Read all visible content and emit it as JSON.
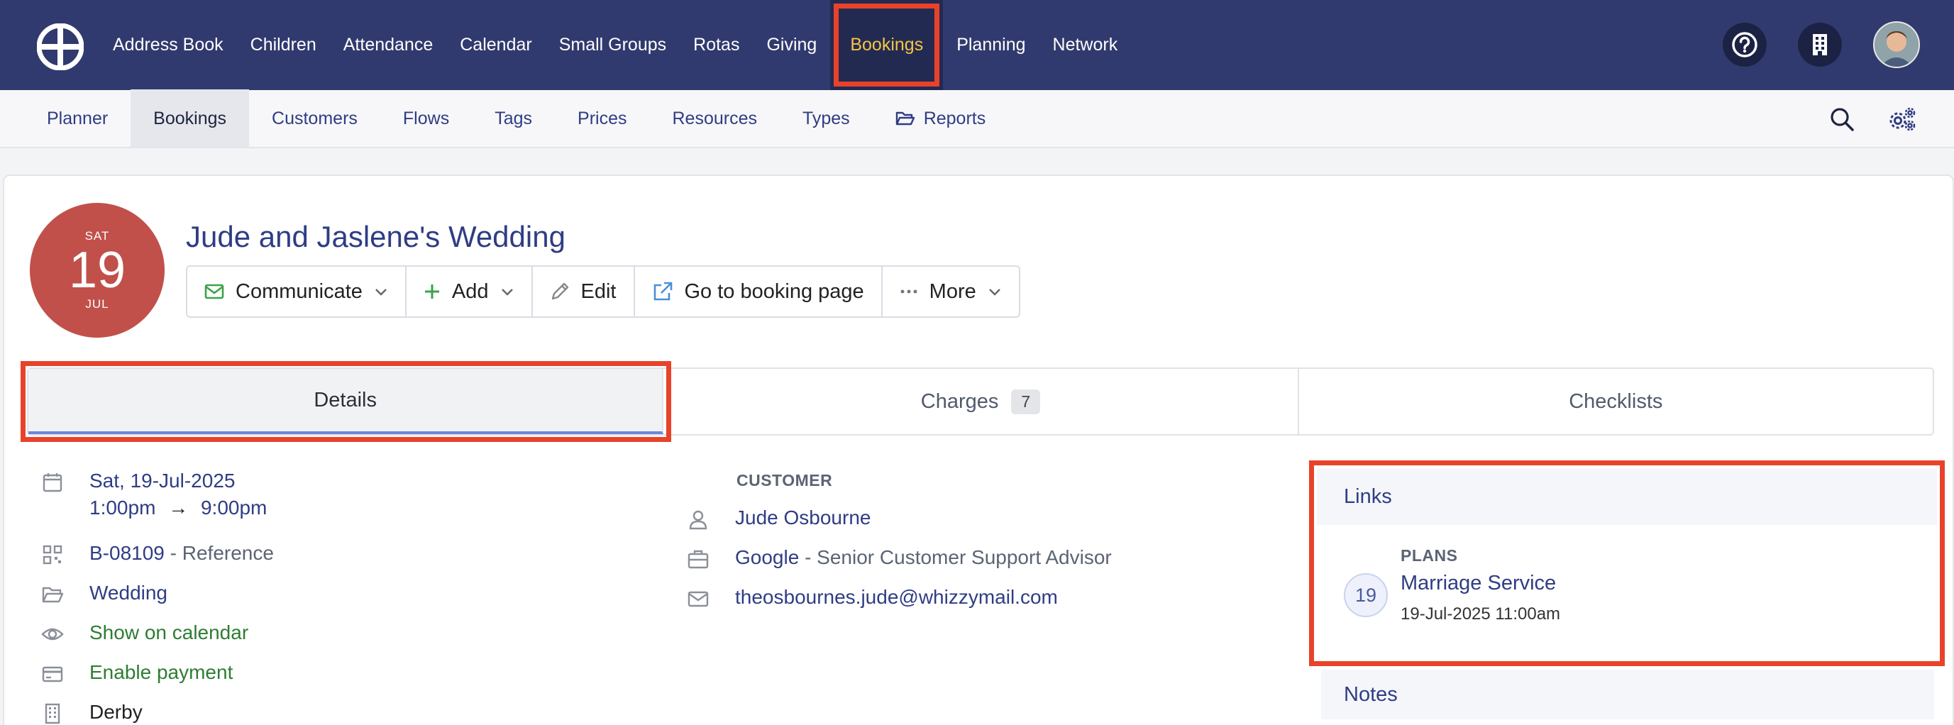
{
  "top_nav": {
    "items": [
      "Address Book",
      "Children",
      "Attendance",
      "Calendar",
      "Small Groups",
      "Rotas",
      "Giving",
      "Bookings",
      "Planning",
      "Network"
    ],
    "active": "Bookings"
  },
  "sub_nav": {
    "items": [
      "Planner",
      "Bookings",
      "Customers",
      "Flows",
      "Tags",
      "Prices",
      "Resources",
      "Types",
      "Reports"
    ],
    "active": "Bookings"
  },
  "booking": {
    "date_badge": {
      "dow": "SAT",
      "day": "19",
      "month": "JUL"
    },
    "title": "Jude and Jaslene's Wedding",
    "actions": [
      "Communicate",
      "Add",
      "Edit",
      "Go to booking page",
      "More"
    ]
  },
  "tabs": [
    {
      "label": "Details",
      "badge": ""
    },
    {
      "label": "Charges",
      "badge": "7"
    },
    {
      "label": "Checklists",
      "badge": ""
    }
  ],
  "details": {
    "date": "Sat, 19-Jul-2025",
    "time_start": "1:00pm",
    "time_arrow": "→",
    "time_end": "9:00pm",
    "reference_code": "B-08109",
    "reference_label": "- Reference",
    "type": "Wedding",
    "calendar": "Show on calendar",
    "payment": "Enable payment",
    "location": "Derby"
  },
  "customer": {
    "section_label": "CUSTOMER",
    "name": "Jude Osbourne",
    "company": "Google",
    "job_title": "- Senior Customer Support Advisor",
    "email": "theosbournes.jude@whizzymail.com"
  },
  "links": {
    "heading": "Links",
    "plans_label": "PLANS",
    "plan_day": "19",
    "plan_name": "Marriage Service",
    "plan_datetime": "19-Jul-2025 11:00am"
  },
  "notes": {
    "heading": "Notes"
  },
  "colors": {
    "topbar": "#313a6e",
    "accent_active": "#f5c542",
    "highlight": "#e8432a",
    "date_badge": "#c1504a",
    "link": "#2f3d84"
  }
}
